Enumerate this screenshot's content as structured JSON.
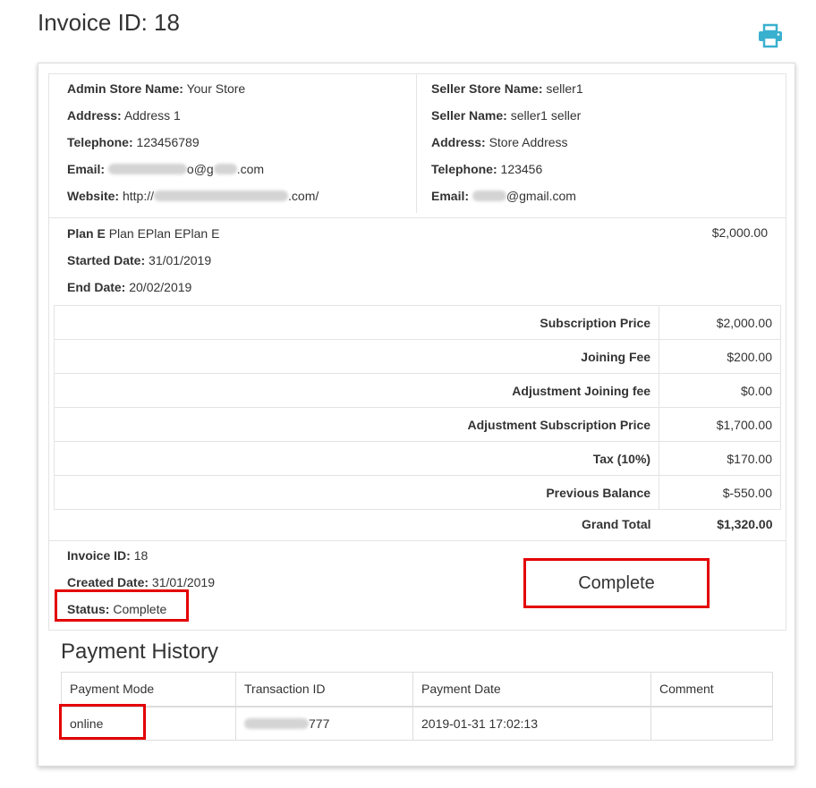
{
  "page": {
    "title": "Invoice ID: 18"
  },
  "icons": {
    "print": "print-icon"
  },
  "admin": {
    "store_name_label": "Admin Store Name:",
    "store_name": "Your Store",
    "address_label": "Address:",
    "address": "Address 1",
    "telephone_label": "Telephone:",
    "telephone": "123456789",
    "email_label": "Email:",
    "email_suffix": "o@g",
    "email_end": ".com",
    "website_label": "Website:",
    "website_prefix": "http://",
    "website_end": ".com/"
  },
  "seller": {
    "store_name_label": "Seller Store Name:",
    "store_name": "seller1",
    "name_label": "Seller Name:",
    "name": "seller1 seller",
    "address_label": "Address:",
    "address": "Store Address",
    "telephone_label": "Telephone:",
    "telephone": "123456",
    "email_label": "Email:",
    "email_end": "@gmail.com"
  },
  "plan": {
    "name_label": "Plan E",
    "name": "Plan EPlan EPlan E",
    "price": "$2,000.00",
    "started_label": "Started Date:",
    "started": "31/01/2019",
    "end_label": "End Date:",
    "end": "20/02/2019"
  },
  "totals": [
    {
      "label": "Subscription Price",
      "value": "$2,000.00"
    },
    {
      "label": "Joining Fee",
      "value": "$200.00"
    },
    {
      "label": "Adjustment Joining fee",
      "value": "$0.00"
    },
    {
      "label": "Adjustment Subscription Price",
      "value": "$1,700.00"
    },
    {
      "label": "Tax (10%)",
      "value": "$170.00"
    },
    {
      "label": "Previous Balance",
      "value": "$-550.00"
    }
  ],
  "grand_total": {
    "label": "Grand Total",
    "value": "$1,320.00"
  },
  "invoice": {
    "id_label": "Invoice ID:",
    "id": "18",
    "created_label": "Created Date:",
    "created": "31/01/2019",
    "status_label": "Status:",
    "status": "Complete",
    "status_display": "Complete"
  },
  "payment_history": {
    "title": "Payment History",
    "columns": [
      "Payment Mode",
      "Transaction ID",
      "Payment Date",
      "Comment"
    ],
    "rows": [
      {
        "mode": "online",
        "transaction_suffix": "777",
        "date": "2019-01-31 17:02:13",
        "comment": ""
      }
    ]
  },
  "colors": {
    "highlight": "#e30000",
    "icon": "#3ab0cf",
    "border": "#e4e4e4"
  }
}
